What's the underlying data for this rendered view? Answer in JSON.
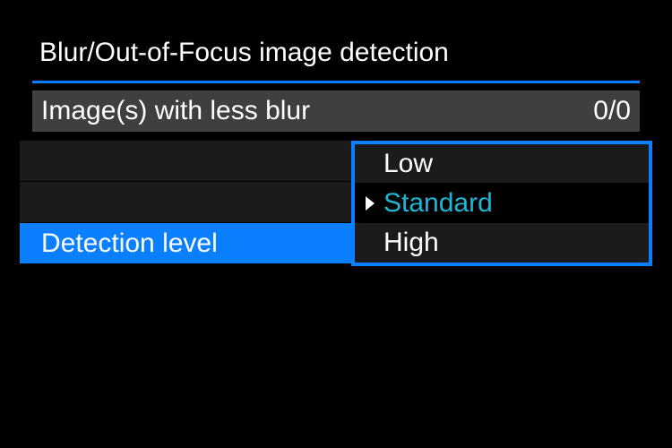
{
  "title": "Blur/Out-of-Focus image detection",
  "status": {
    "label": "Image(s) with less blur",
    "value": "0/0"
  },
  "row3_label": "Detection level",
  "dropdown": {
    "item0": "Low",
    "item1": "Standard",
    "item2": "High",
    "selected_index": 1
  }
}
